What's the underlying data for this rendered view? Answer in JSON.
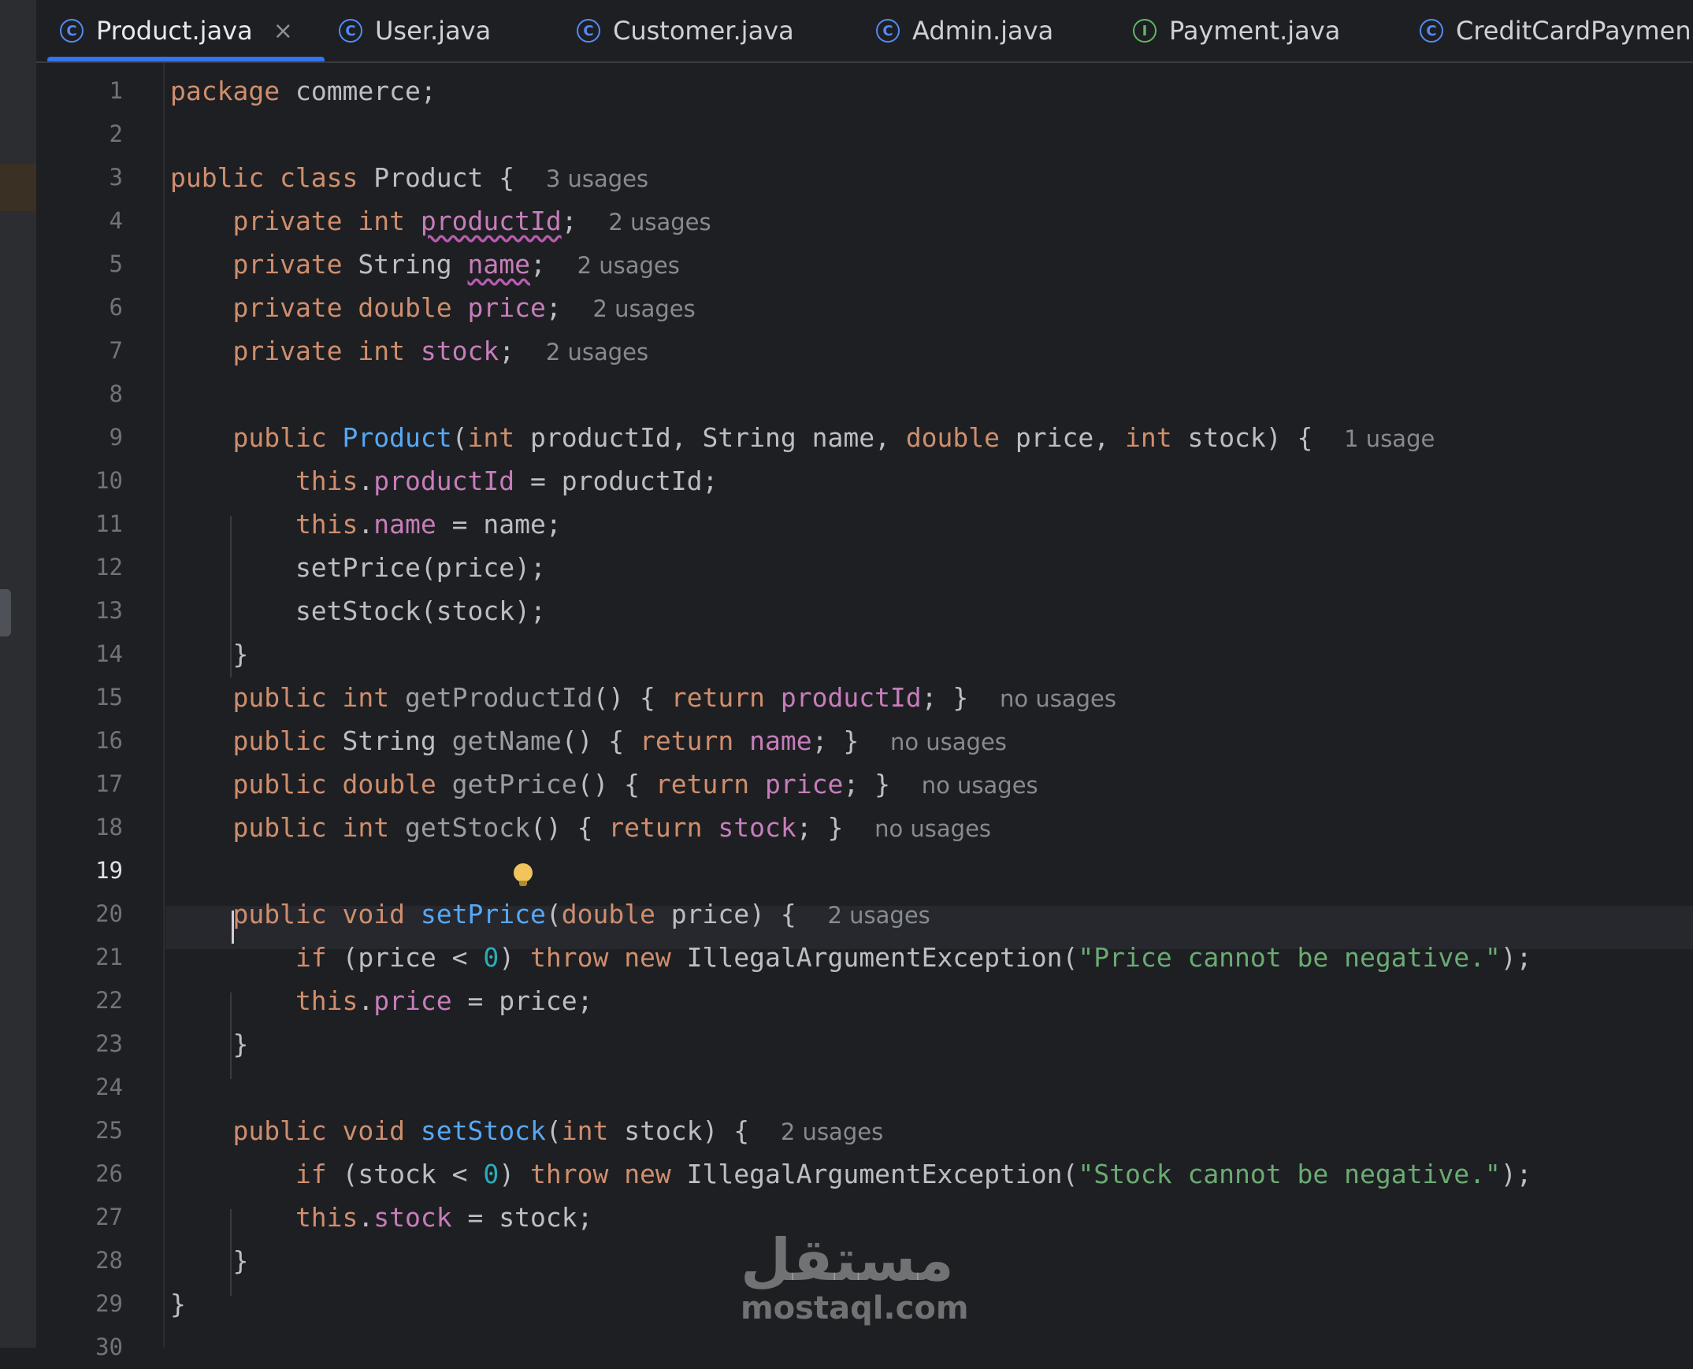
{
  "tabs": [
    {
      "label": "Product.java",
      "icon": "class-icon",
      "icon_glyph": "C",
      "active": true,
      "closable": true
    },
    {
      "label": "User.java",
      "icon": "class-icon",
      "icon_glyph": "C"
    },
    {
      "label": "Customer.java",
      "icon": "class-icon",
      "icon_glyph": "C"
    },
    {
      "label": "Admin.java",
      "icon": "class-icon",
      "icon_glyph": "C"
    },
    {
      "label": "Payment.java",
      "icon": "interface-icon",
      "icon_glyph": "I"
    },
    {
      "label": "CreditCardPaymen",
      "icon": "class-icon",
      "icon_glyph": "C"
    }
  ],
  "close_glyph": "×",
  "current_line": 19,
  "line_numbers": [
    "1",
    "2",
    "3",
    "4",
    "5",
    "6",
    "7",
    "8",
    "9",
    "10",
    "11",
    "12",
    "13",
    "14",
    "15",
    "16",
    "17",
    "18",
    "19",
    "20",
    "21",
    "22",
    "23",
    "24",
    "25",
    "26",
    "27",
    "28",
    "29",
    "30"
  ],
  "code": [
    [
      {
        "t": "package ",
        "c": "kw"
      },
      {
        "t": "commerce;"
      }
    ],
    [],
    [
      {
        "t": "public class ",
        "c": "kw"
      },
      {
        "t": "Product {  "
      },
      {
        "t": "3 usages",
        "c": "hint"
      }
    ],
    [
      {
        "t": "    private int ",
        "c": "kw"
      },
      {
        "t": "productId",
        "c": "fld squig"
      },
      {
        "t": ";  "
      },
      {
        "t": "2 usages",
        "c": "hint"
      }
    ],
    [
      {
        "t": "    private ",
        "c": "kw"
      },
      {
        "t": "String "
      },
      {
        "t": "name",
        "c": "fld squig"
      },
      {
        "t": ";  "
      },
      {
        "t": "2 usages",
        "c": "hint"
      }
    ],
    [
      {
        "t": "    private double ",
        "c": "kw"
      },
      {
        "t": "price",
        "c": "fld"
      },
      {
        "t": ";  "
      },
      {
        "t": "2 usages",
        "c": "hint"
      }
    ],
    [
      {
        "t": "    private int ",
        "c": "kw"
      },
      {
        "t": "stock",
        "c": "fld"
      },
      {
        "t": ";  "
      },
      {
        "t": "2 usages",
        "c": "hint"
      }
    ],
    [],
    [
      {
        "t": "    public ",
        "c": "kw"
      },
      {
        "t": "Product",
        "c": "fn"
      },
      {
        "t": "("
      },
      {
        "t": "int ",
        "c": "kw"
      },
      {
        "t": "productId, String name, "
      },
      {
        "t": "double ",
        "c": "kw"
      },
      {
        "t": "price, "
      },
      {
        "t": "int ",
        "c": "kw"
      },
      {
        "t": "stock) {  "
      },
      {
        "t": "1 usage",
        "c": "hint"
      }
    ],
    [
      {
        "t": "        this",
        "c": "kw"
      },
      {
        "t": "."
      },
      {
        "t": "productId",
        "c": "fld"
      },
      {
        "t": " = productId;"
      }
    ],
    [
      {
        "t": "        this",
        "c": "kw"
      },
      {
        "t": "."
      },
      {
        "t": "name",
        "c": "fld"
      },
      {
        "t": " = name;"
      }
    ],
    [
      {
        "t": "        setPrice(price);"
      }
    ],
    [
      {
        "t": "        setStock(stock);"
      }
    ],
    [
      {
        "t": "    }"
      }
    ],
    [
      {
        "t": "    public int ",
        "c": "kw"
      },
      {
        "t": "getProductId",
        "c": "unused"
      },
      {
        "t": "() { "
      },
      {
        "t": "return ",
        "c": "kw"
      },
      {
        "t": "productId",
        "c": "fld"
      },
      {
        "t": "; }  "
      },
      {
        "t": "no usages",
        "c": "hint"
      }
    ],
    [
      {
        "t": "    public ",
        "c": "kw"
      },
      {
        "t": "String "
      },
      {
        "t": "getName",
        "c": "unused"
      },
      {
        "t": "() { "
      },
      {
        "t": "return ",
        "c": "kw"
      },
      {
        "t": "name",
        "c": "fld"
      },
      {
        "t": "; }  "
      },
      {
        "t": "no usages",
        "c": "hint"
      }
    ],
    [
      {
        "t": "    public double ",
        "c": "kw"
      },
      {
        "t": "getPrice",
        "c": "unused"
      },
      {
        "t": "() { "
      },
      {
        "t": "return ",
        "c": "kw"
      },
      {
        "t": "price",
        "c": "fld"
      },
      {
        "t": "; }  "
      },
      {
        "t": "no usages",
        "c": "hint"
      }
    ],
    [
      {
        "t": "    public int ",
        "c": "kw"
      },
      {
        "t": "getStock",
        "c": "unused"
      },
      {
        "t": "() { "
      },
      {
        "t": "return ",
        "c": "kw"
      },
      {
        "t": "stock",
        "c": "fld"
      },
      {
        "t": "; }  "
      },
      {
        "t": "no usages",
        "c": "hint"
      }
    ],
    [],
    [
      {
        "t": "    public void ",
        "c": "kw"
      },
      {
        "t": "setPrice",
        "c": "fn"
      },
      {
        "t": "("
      },
      {
        "t": "double ",
        "c": "kw"
      },
      {
        "t": "price) {  "
      },
      {
        "t": "2 usages",
        "c": "hint"
      }
    ],
    [
      {
        "t": "        if ",
        "c": "kw"
      },
      {
        "t": "(price < "
      },
      {
        "t": "0",
        "c": "num"
      },
      {
        "t": ") "
      },
      {
        "t": "throw new ",
        "c": "kw"
      },
      {
        "t": "IllegalArgumentException("
      },
      {
        "t": "\"Price cannot be negative.\"",
        "c": "str"
      },
      {
        "t": ");"
      }
    ],
    [
      {
        "t": "        this",
        "c": "kw"
      },
      {
        "t": "."
      },
      {
        "t": "price",
        "c": "fld"
      },
      {
        "t": " = price;"
      }
    ],
    [
      {
        "t": "    }"
      }
    ],
    [],
    [
      {
        "t": "    public void ",
        "c": "kw"
      },
      {
        "t": "setStock",
        "c": "fn"
      },
      {
        "t": "("
      },
      {
        "t": "int ",
        "c": "kw"
      },
      {
        "t": "stock) {  "
      },
      {
        "t": "2 usages",
        "c": "hint"
      }
    ],
    [
      {
        "t": "        if ",
        "c": "kw"
      },
      {
        "t": "(stock < "
      },
      {
        "t": "0",
        "c": "num"
      },
      {
        "t": ") "
      },
      {
        "t": "throw new ",
        "c": "kw"
      },
      {
        "t": "IllegalArgumentException("
      },
      {
        "t": "\"Stock cannot be negative.\"",
        "c": "str"
      },
      {
        "t": ");"
      }
    ],
    [
      {
        "t": "        this",
        "c": "kw"
      },
      {
        "t": "."
      },
      {
        "t": "stock",
        "c": "fld"
      },
      {
        "t": " = stock;"
      }
    ],
    [
      {
        "t": "    }"
      }
    ],
    [
      {
        "t": "}"
      }
    ],
    []
  ],
  "watermark": {
    "arabic": "مستقل",
    "latin": "mostaql.com"
  },
  "colors": {
    "background": "#1e1f22",
    "keyword": "#cf8e6d",
    "field": "#c77dbb",
    "method_decl": "#56a8f5",
    "string": "#6aab73",
    "number": "#2aacb8",
    "hint": "#868a91",
    "accent": "#3574f0"
  }
}
